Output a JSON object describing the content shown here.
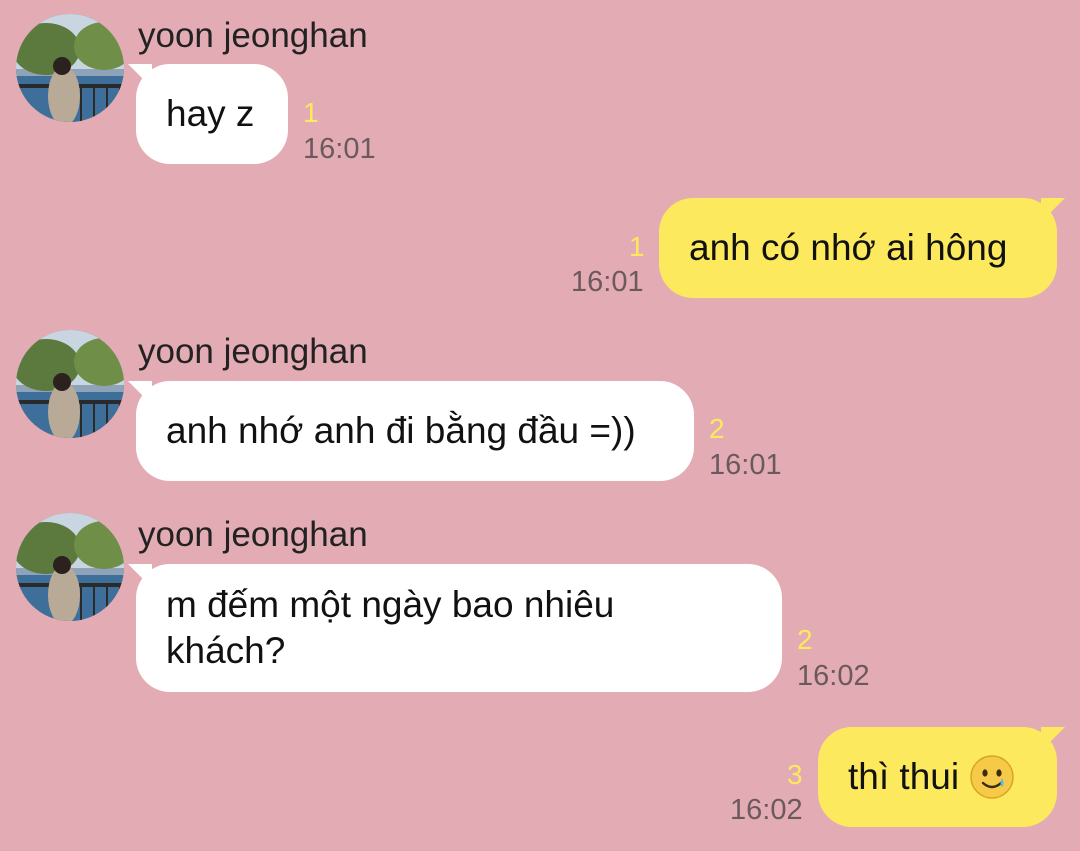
{
  "contact": {
    "name": "yoon jeonghan"
  },
  "colors": {
    "background": "#e3abb3",
    "incoming_bubble": "#ffffff",
    "outgoing_bubble": "#fde95e",
    "unread_count": "#fde95e",
    "timestamp": "#6a5a5e"
  },
  "messages": [
    {
      "direction": "incoming",
      "sender": "yoon jeonghan",
      "text": "hay z",
      "unread": "1",
      "time": "16:01",
      "avatar_icon": "profile-photo"
    },
    {
      "direction": "outgoing",
      "text": "anh có nhớ ai hông",
      "unread": "1",
      "time": "16:01"
    },
    {
      "direction": "incoming",
      "sender": "yoon jeonghan",
      "text": "anh nhớ anh đi bằng đầu =))",
      "unread": "2",
      "time": "16:01",
      "avatar_icon": "profile-photo"
    },
    {
      "direction": "incoming",
      "sender": "yoon jeonghan",
      "text": "m đếm một ngày bao nhiêu\nkhách?",
      "unread": "2",
      "time": "16:02",
      "avatar_icon": "profile-photo"
    },
    {
      "direction": "outgoing",
      "text": "thì thui",
      "emoji": "smiling-face-with-tear-emoji",
      "unread": "3",
      "time": "16:02"
    }
  ]
}
